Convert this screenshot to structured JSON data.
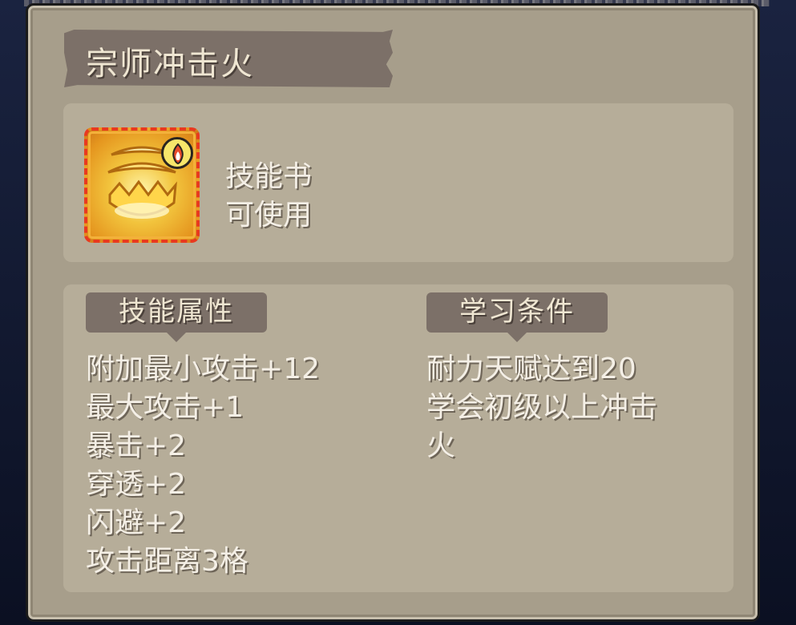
{
  "skill_title": "宗师冲击火",
  "item": {
    "icon": "golden-fire-skill-book-icon",
    "badge_icon": "flame-badge-icon",
    "type": "技能书",
    "status": "可使用"
  },
  "attributes": {
    "heading": "技能属性",
    "lines": [
      "附加最小攻击+12",
      "最大攻击+1",
      "暴击+2",
      "穿透+2",
      "闪避+2",
      "攻击距离3格"
    ]
  },
  "requirements": {
    "heading": "学习条件",
    "lines": [
      "耐力天赋达到20",
      "学会初级以上冲击",
      "火"
    ]
  },
  "colors": {
    "panel": "#a79e8b",
    "banner": "#7c7068",
    "text": "#f4efe6",
    "icon_border": "#e8391f"
  }
}
